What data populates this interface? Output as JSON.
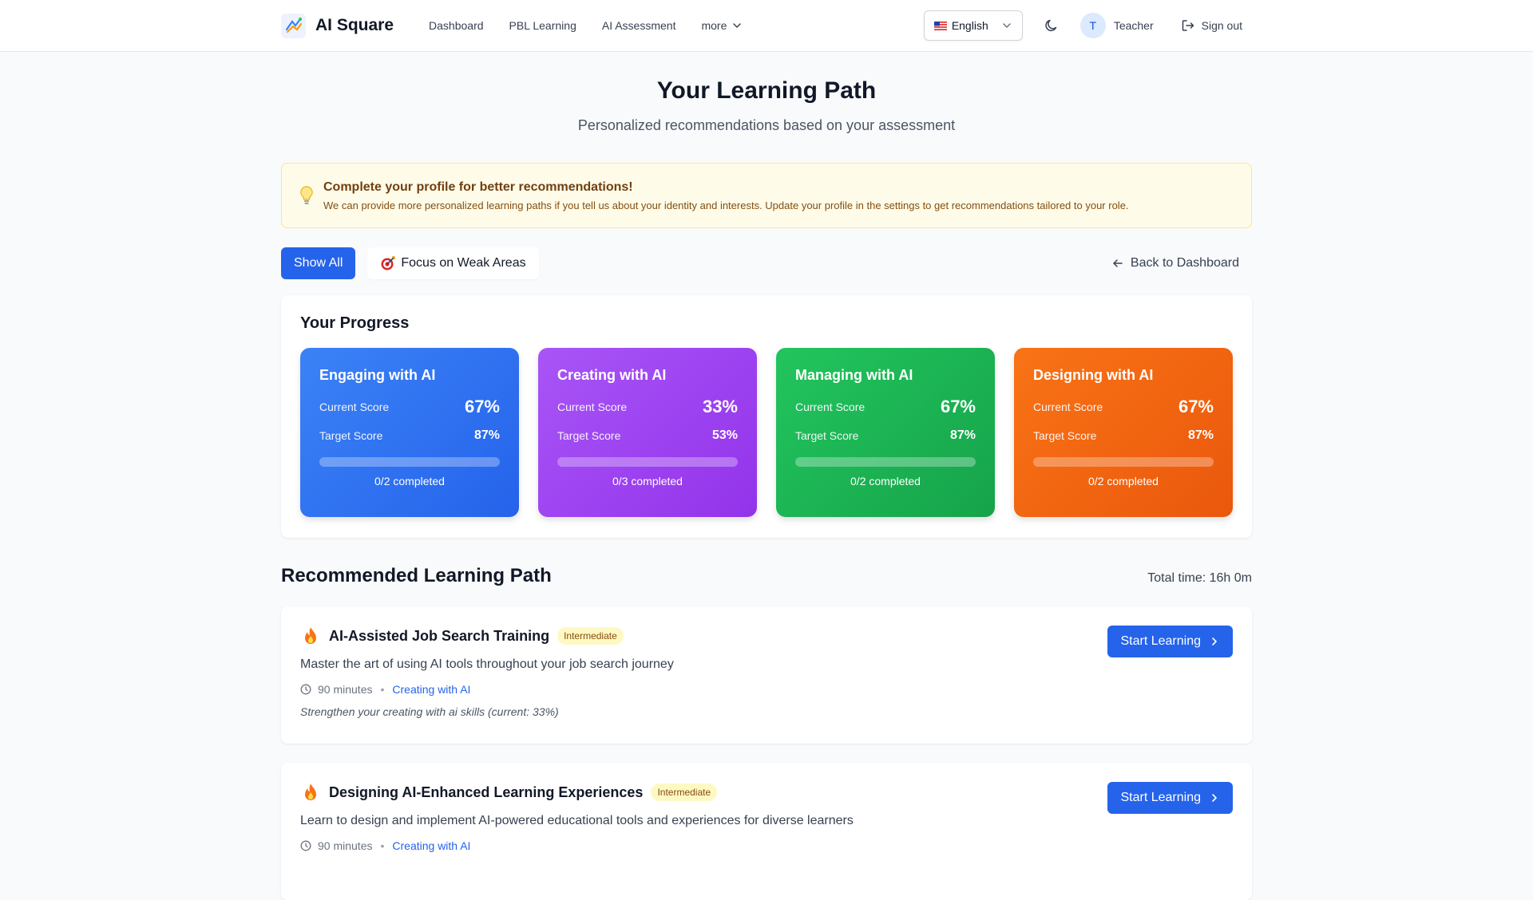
{
  "header": {
    "brand": "AI Square",
    "nav": [
      {
        "label": "Dashboard"
      },
      {
        "label": "PBL Learning"
      },
      {
        "label": "AI Assessment"
      },
      {
        "label": "more"
      }
    ],
    "language": "English",
    "user_initial": "T",
    "user_name": "Teacher",
    "signout": "Sign out"
  },
  "page": {
    "title": "Your Learning Path",
    "subtitle": "Personalized recommendations based on your assessment"
  },
  "notice": {
    "title": "Complete your profile for better recommendations!",
    "body": "We can provide more personalized learning paths if you tell us about your identity and interests. Update your profile in the settings to get recommendations tailored to your role."
  },
  "filters": {
    "show_all": "Show All",
    "focus_weak": "Focus on Weak Areas",
    "back": "Back to Dashboard"
  },
  "progress": {
    "heading": "Your Progress",
    "current_label": "Current Score",
    "target_label": "Target Score",
    "domains": [
      {
        "name": "Engaging with AI",
        "current": "67%",
        "target": "87%",
        "completed": "0/2 completed",
        "progress": 0,
        "color_from": "#3b82f6",
        "color_to": "#2563eb"
      },
      {
        "name": "Creating with AI",
        "current": "33%",
        "target": "53%",
        "completed": "0/3 completed",
        "progress": 0,
        "color_from": "#a855f7",
        "color_to": "#9333ea"
      },
      {
        "name": "Managing with AI",
        "current": "67%",
        "target": "87%",
        "completed": "0/2 completed",
        "progress": 0,
        "color_from": "#22c55e",
        "color_to": "#16a34a"
      },
      {
        "name": "Designing with AI",
        "current": "67%",
        "target": "87%",
        "completed": "0/2 completed",
        "progress": 0,
        "color_from": "#f97316",
        "color_to": "#ea580c"
      }
    ]
  },
  "recommended": {
    "heading": "Recommended Learning Path",
    "total_time": "Total time: 16h 0m",
    "start_label": "Start Learning",
    "paths": [
      {
        "title": "AI-Assisted Job Search Training",
        "badge": "Intermediate",
        "description": "Master the art of using AI tools throughout your job search journey",
        "duration": "90 minutes",
        "domain": "Creating with AI",
        "note": "Strengthen your creating with ai skills (current: 33%)"
      },
      {
        "title": "Designing AI-Enhanced Learning Experiences",
        "badge": "Intermediate",
        "description": "Learn to design and implement AI-powered educational tools and experiences for diverse learners",
        "duration": "90 minutes",
        "domain": "Creating with AI",
        "note": ""
      }
    ]
  },
  "colors": {
    "primary": "#2563eb",
    "notice_bg": "#fefce8",
    "badge_bg": "#fef9c3"
  },
  "icons": [
    "logo-icon",
    "chevron-down-icon",
    "flag-us-icon",
    "moon-icon",
    "signout-icon",
    "lightbulb-icon",
    "target-icon",
    "arrow-left-icon",
    "fire-icon",
    "clock-icon",
    "chevron-right-icon"
  ]
}
